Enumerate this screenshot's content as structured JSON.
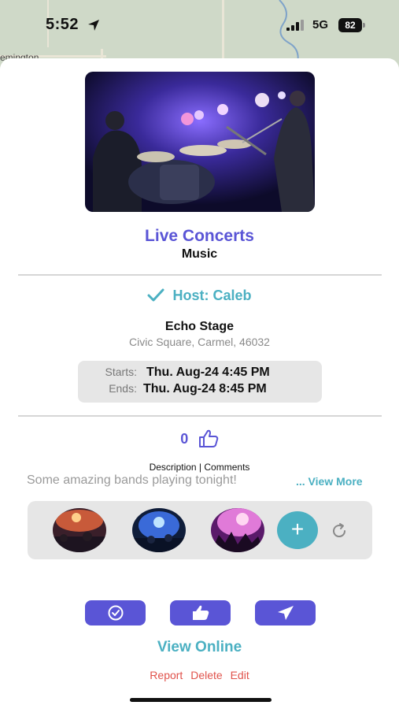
{
  "status_bar": {
    "time": "5:52",
    "network": "5G",
    "battery": "82"
  },
  "map": {
    "label": "emington"
  },
  "event": {
    "title": "Live Concerts",
    "category": "Music",
    "host": "Host: Caleb",
    "venue_name": "Echo Stage",
    "venue_address": "Civic Square, Carmel, 46032",
    "starts_label": "Starts:",
    "starts_value": "Thu. Aug-24 4:45 PM",
    "ends_label": "Ends:",
    "ends_value": "Thu. Aug-24 8:45 PM",
    "like_count": "0",
    "tabs_label": "Description | Comments",
    "description": "Some amazing bands playing tonight!",
    "view_more": "... View More"
  },
  "gallery": {
    "add_label": "+"
  },
  "actions": {
    "view_online": "View Online",
    "report": "Report",
    "delete": "Delete",
    "edit": "Edit"
  },
  "colors": {
    "primary": "#5a55d6",
    "accent": "#4bb0c2",
    "danger": "#e0524b"
  }
}
